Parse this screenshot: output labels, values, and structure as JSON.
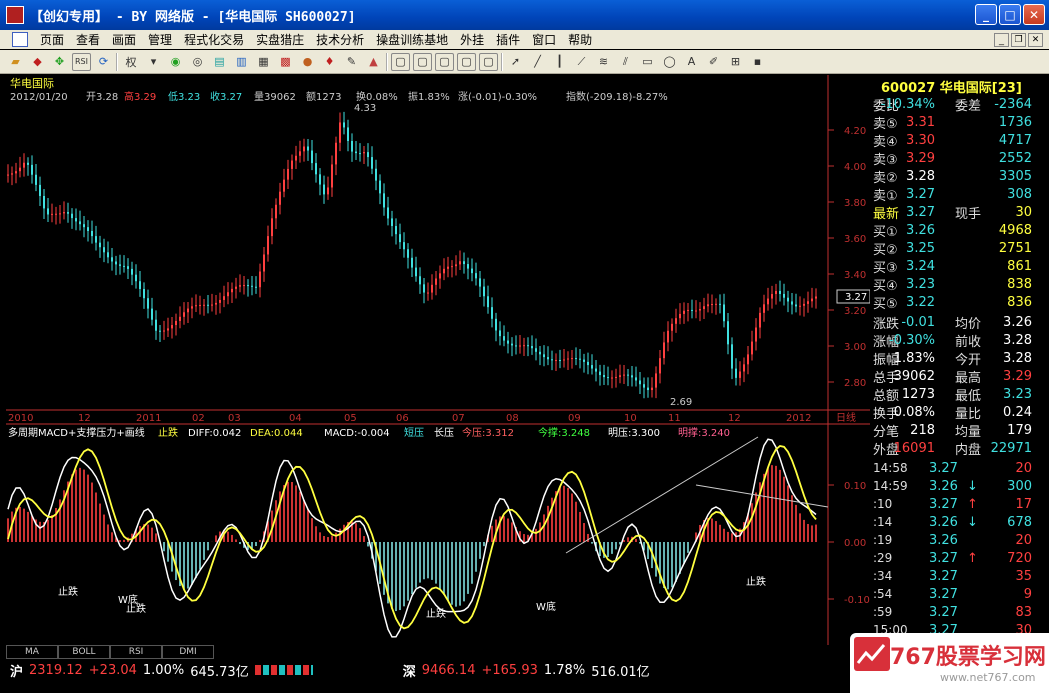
{
  "window": {
    "title": "【创幻专用】 - BY 网络版 - [华电国际 SH600027]",
    "buttons": [
      "_",
      "□",
      "✕"
    ]
  },
  "menu": {
    "items": [
      "页面",
      "查看",
      "画面",
      "管理",
      "程式化交易",
      "实盘猎庄",
      "技术分析",
      "操盘训练基地",
      "外挂",
      "插件",
      "窗口",
      "帮助"
    ]
  },
  "toolbar": {
    "quan_label": "权"
  },
  "stock": {
    "name": "华电国际",
    "code": "600027",
    "code_full": "600027 华电国际[23]"
  },
  "ohlc_line": {
    "date": "2012/01/20",
    "open": "开3.28",
    "high": "高3.29",
    "low": "低3.23",
    "close": "收3.27",
    "vol": "量39062",
    "amt": "额1273",
    "turnover": "换0.08%",
    "amp": "振1.83%",
    "chg": "涨(-0.01)-0.30%",
    "index": "指数(-209.18)-8.27%"
  },
  "price_axis": {
    "ticks": [
      "4.20",
      "4.00",
      "3.80",
      "3.60",
      "3.40",
      "3.20",
      "3.00",
      "2.80"
    ],
    "current": "3.27"
  },
  "annotations": {
    "high": "4.33",
    "low": "2.69"
  },
  "time_axis": {
    "labels": [
      "2010",
      "12",
      "2011",
      "02",
      "03",
      "04",
      "05",
      "06",
      "07",
      "08",
      "09",
      "10",
      "11",
      "12",
      "2012",
      "日线"
    ]
  },
  "indicator_line": {
    "name": "多周期MACD+支撑压力+画线",
    "signal": "止跌",
    "diff": "DIFF:0.042",
    "dea": "DEA:0.044",
    "macd": "MACD:-0.004",
    "short": "短压",
    "long": "长压",
    "jinya": "今压:3.312",
    "jincheng": "今撑:3.248",
    "mingya": "明压:3.300",
    "mingcheng": "明撑:3.240"
  },
  "macd_axis": {
    "ticks": [
      "0.10",
      "0.00",
      "-0.10"
    ]
  },
  "macd_labels": [
    "止跌",
    "W底",
    "止跌",
    "止跌",
    "W底",
    "止跌"
  ],
  "bottom_tabs": [
    "MA",
    "BOLL",
    "RSI",
    "DMI"
  ],
  "quote": {
    "weibi": {
      "label": "委比",
      "value": "-10.34%",
      "label2": "委差",
      "value2": "-2364"
    },
    "sells": [
      {
        "label": "卖⑤",
        "price": "3.31",
        "vol": "1736"
      },
      {
        "label": "卖④",
        "price": "3.30",
        "vol": "4717"
      },
      {
        "label": "卖③",
        "price": "3.29",
        "vol": "2552"
      },
      {
        "label": "卖②",
        "price": "3.28",
        "vol": "3305"
      },
      {
        "label": "卖①",
        "price": "3.27",
        "vol": "308"
      }
    ],
    "latest": {
      "label": "最新",
      "price": "3.27",
      "label2": "现手",
      "vol": "30"
    },
    "buys": [
      {
        "label": "买①",
        "price": "3.26",
        "vol": "4968"
      },
      {
        "label": "买②",
        "price": "3.25",
        "vol": "2751"
      },
      {
        "label": "买③",
        "price": "3.24",
        "vol": "861"
      },
      {
        "label": "买④",
        "price": "3.23",
        "vol": "838"
      },
      {
        "label": "买⑤",
        "price": "3.22",
        "vol": "836"
      }
    ],
    "stats": [
      {
        "l1": "涨跌",
        "v1": "-0.01",
        "l2": "均价",
        "v2": "3.26"
      },
      {
        "l1": "涨幅",
        "v1": "-0.30%",
        "l2": "前收",
        "v2": "3.28"
      },
      {
        "l1": "振幅",
        "v1": "1.83%",
        "l2": "今开",
        "v2": "3.28"
      },
      {
        "l1": "总手",
        "v1": "39062",
        "l2": "最高",
        "v2": "3.29"
      },
      {
        "l1": "总额",
        "v1": "1273",
        "l2": "最低",
        "v2": "3.23"
      },
      {
        "l1": "换手",
        "v1": "0.08%",
        "l2": "量比",
        "v2": "0.24"
      },
      {
        "l1": "分笔",
        "v1": "218",
        "l2": "均量",
        "v2": "179"
      }
    ],
    "waipan": {
      "label": "外盘",
      "value": "16091",
      "label2": "内盘",
      "value2": "22971"
    },
    "ticks": [
      {
        "t": "14:58",
        "p": "3.27",
        "a": "",
        "v": "20"
      },
      {
        "t": "14:59",
        "p": "3.26",
        "a": "↓",
        "v": "300"
      },
      {
        "t": ":10",
        "p": "3.27",
        "a": "↑",
        "v": "17"
      },
      {
        "t": ":14",
        "p": "3.26",
        "a": "↓",
        "v": "678"
      },
      {
        "t": ":19",
        "p": "3.26",
        "a": "",
        "v": "20"
      },
      {
        "t": ":29",
        "p": "3.27",
        "a": "↑",
        "v": "720"
      },
      {
        "t": ":34",
        "p": "3.27",
        "a": "",
        "v": "35"
      },
      {
        "t": ":54",
        "p": "3.27",
        "a": "",
        "v": "9"
      },
      {
        "t": ":59",
        "p": "3.27",
        "a": "",
        "v": "83"
      },
      {
        "t": "15:00",
        "p": "3.27",
        "a": "",
        "v": "30"
      }
    ]
  },
  "status": {
    "sh_label": "沪",
    "sh_index": "2319.12",
    "sh_chg": "+23.04",
    "sh_pct": "1.00%",
    "sh_amt": "645.73亿",
    "sz_label": "深",
    "sz_index": "9466.14",
    "sz_chg": "+165.93",
    "sz_pct": "1.78%",
    "sz_amt": "516.01亿"
  },
  "watermark": {
    "text": "767股票学习网",
    "url": "www.net767.com"
  },
  "colors": {
    "up": "#ff4040",
    "down": "#40e0e0",
    "ma_white": "#ffffff",
    "ma_yellow": "#ffff40",
    "axis": "#c03030"
  }
}
